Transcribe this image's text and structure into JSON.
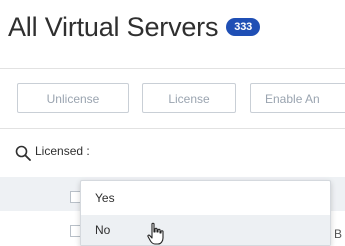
{
  "page": {
    "title": "All Virtual Servers",
    "count_badge": "333"
  },
  "toolbar": {
    "buttons": [
      {
        "label": "Unlicense"
      },
      {
        "label": "License"
      },
      {
        "label": "Enable An"
      }
    ]
  },
  "search": {
    "icon": "search-icon",
    "filter_text": "Licensed :"
  },
  "table": {
    "row_tail_text": "B"
  },
  "dropdown": {
    "options": [
      {
        "label": "Yes",
        "hovered": false
      },
      {
        "label": "No",
        "hovered": true
      }
    ]
  },
  "colors": {
    "badge_bg": "#1f4fb5",
    "button_border": "#c9cfd6",
    "button_text": "#9aa4b0",
    "hover_bg": "#edf0f3"
  },
  "cursor": "hand-pointer-icon"
}
